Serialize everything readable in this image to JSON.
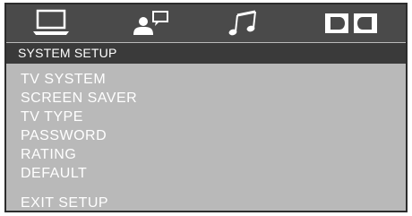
{
  "tabs": [
    {
      "icon": "tv-monitor-icon"
    },
    {
      "icon": "user-speech-icon"
    },
    {
      "icon": "music-note-icon"
    },
    {
      "icon": "dolby-icon"
    }
  ],
  "header": {
    "title": "SYSTEM SETUP"
  },
  "menu": {
    "items": [
      {
        "label": "TV SYSTEM"
      },
      {
        "label": "SCREEN SAVER"
      },
      {
        "label": "TV TYPE"
      },
      {
        "label": "PASSWORD"
      },
      {
        "label": "RATING"
      },
      {
        "label": "DEFAULT"
      }
    ],
    "exit_label": "EXIT  SETUP"
  },
  "colors": {
    "panel": "#b9b9b9",
    "tabbar": "#4a4a4a",
    "header": "#3a3a3a",
    "text": "#ffffff"
  }
}
